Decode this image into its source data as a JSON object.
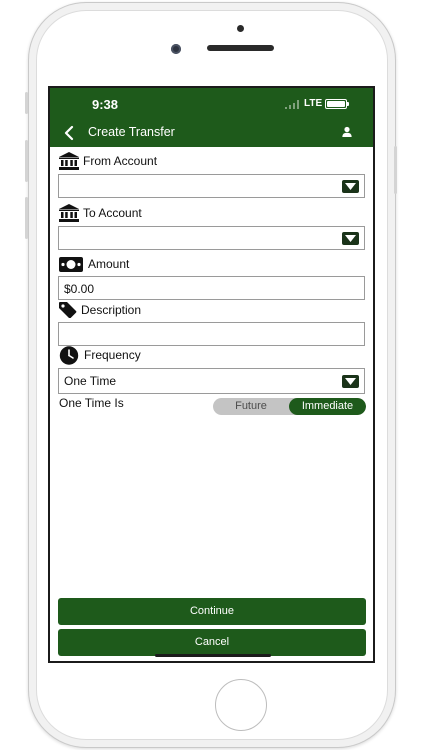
{
  "status_bar": {
    "time": "9:38",
    "network": "LTE"
  },
  "nav": {
    "title": "Create Transfer"
  },
  "form": {
    "from_account": {
      "label": "From Account",
      "value": ""
    },
    "to_account": {
      "label": "To Account",
      "value": ""
    },
    "amount": {
      "label": "Amount",
      "value": "$0.00"
    },
    "description": {
      "label": "Description",
      "value": ""
    },
    "frequency": {
      "label": "Frequency",
      "value": "One Time"
    },
    "one_time_is": {
      "label": "One Time Is",
      "options": [
        "Future",
        "Immediate"
      ],
      "selected": "Immediate"
    }
  },
  "buttons": {
    "continue": "Continue",
    "cancel": "Cancel"
  },
  "colors": {
    "brand_green": "#1e5a1b",
    "dark_button": "#1a3319"
  },
  "icons": {
    "back": "chevron-left-icon",
    "user": "user-icon",
    "bank": "bank-icon",
    "money": "money-icon",
    "tag": "tag-icon",
    "clock": "clock-icon",
    "dropdown": "caret-down-icon"
  }
}
